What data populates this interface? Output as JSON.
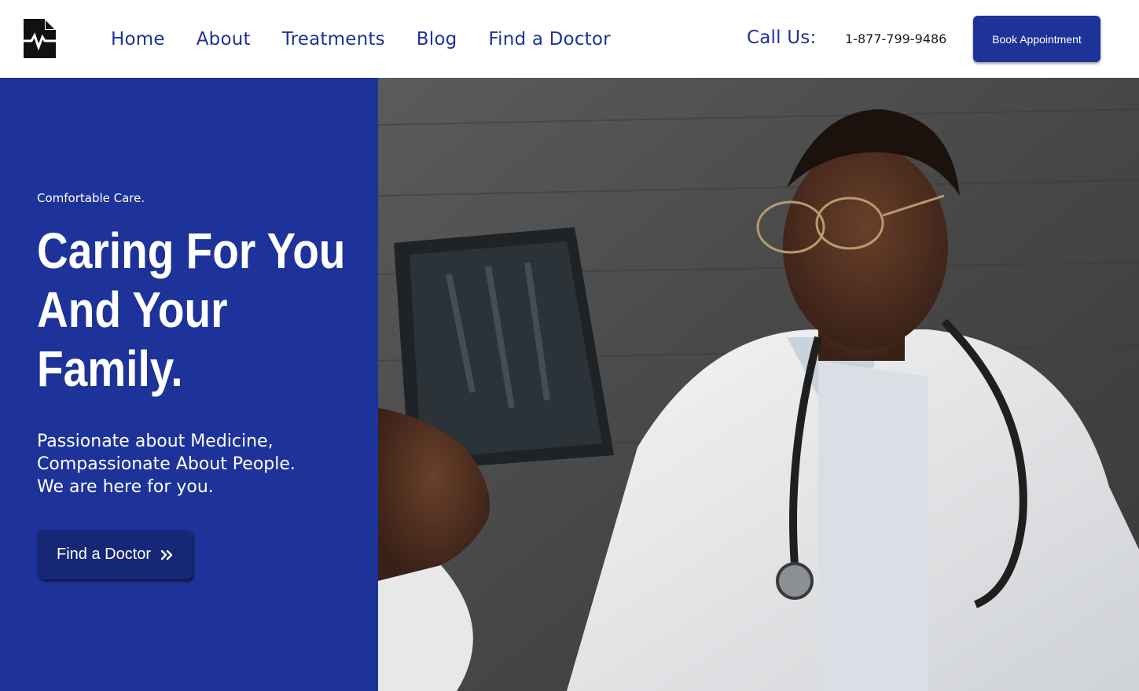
{
  "header": {
    "logo_icon": "medical-document-pulse-icon",
    "nav": [
      {
        "label": "Home"
      },
      {
        "label": "About"
      },
      {
        "label": "Treatments"
      },
      {
        "label": "Blog"
      },
      {
        "label": "Find a Doctor"
      }
    ],
    "call_label": "Call Us:",
    "phone": "1-877-799-9486",
    "book_label": "Book Appointment"
  },
  "hero": {
    "eyebrow": "Comfortable Care.",
    "headline": [
      "Caring For You",
      "And Your",
      "Family."
    ],
    "subtext": [
      "Passionate about Medicine,",
      "Compassionate About People.",
      "We are here for you."
    ],
    "cta_label": "Find a Doctor",
    "cta_icon": "double-chevron-right-icon"
  },
  "colors": {
    "brand_blue": "#1d3399",
    "button_dark_blue": "#162776",
    "nav_text": "#1e3399"
  }
}
